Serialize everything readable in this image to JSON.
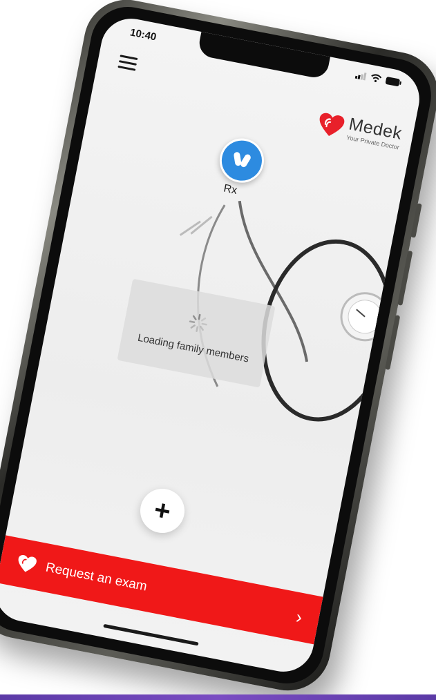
{
  "status_bar": {
    "time": "10:40"
  },
  "brand": {
    "name": "Medek",
    "tagline": "Your Private Doctor",
    "color": "#e8202a"
  },
  "rx": {
    "label": "Rx",
    "color": "#2d8be0"
  },
  "loading": {
    "message": "Loading family members"
  },
  "request": {
    "label": "Request an exam",
    "color": "#f01818"
  },
  "icons": [
    "menu-icon",
    "signal-icon",
    "wifi-icon",
    "battery-icon",
    "heart-logo-icon",
    "pills-icon",
    "spinner-icon",
    "plus-icon",
    "chevron-right-icon"
  ]
}
